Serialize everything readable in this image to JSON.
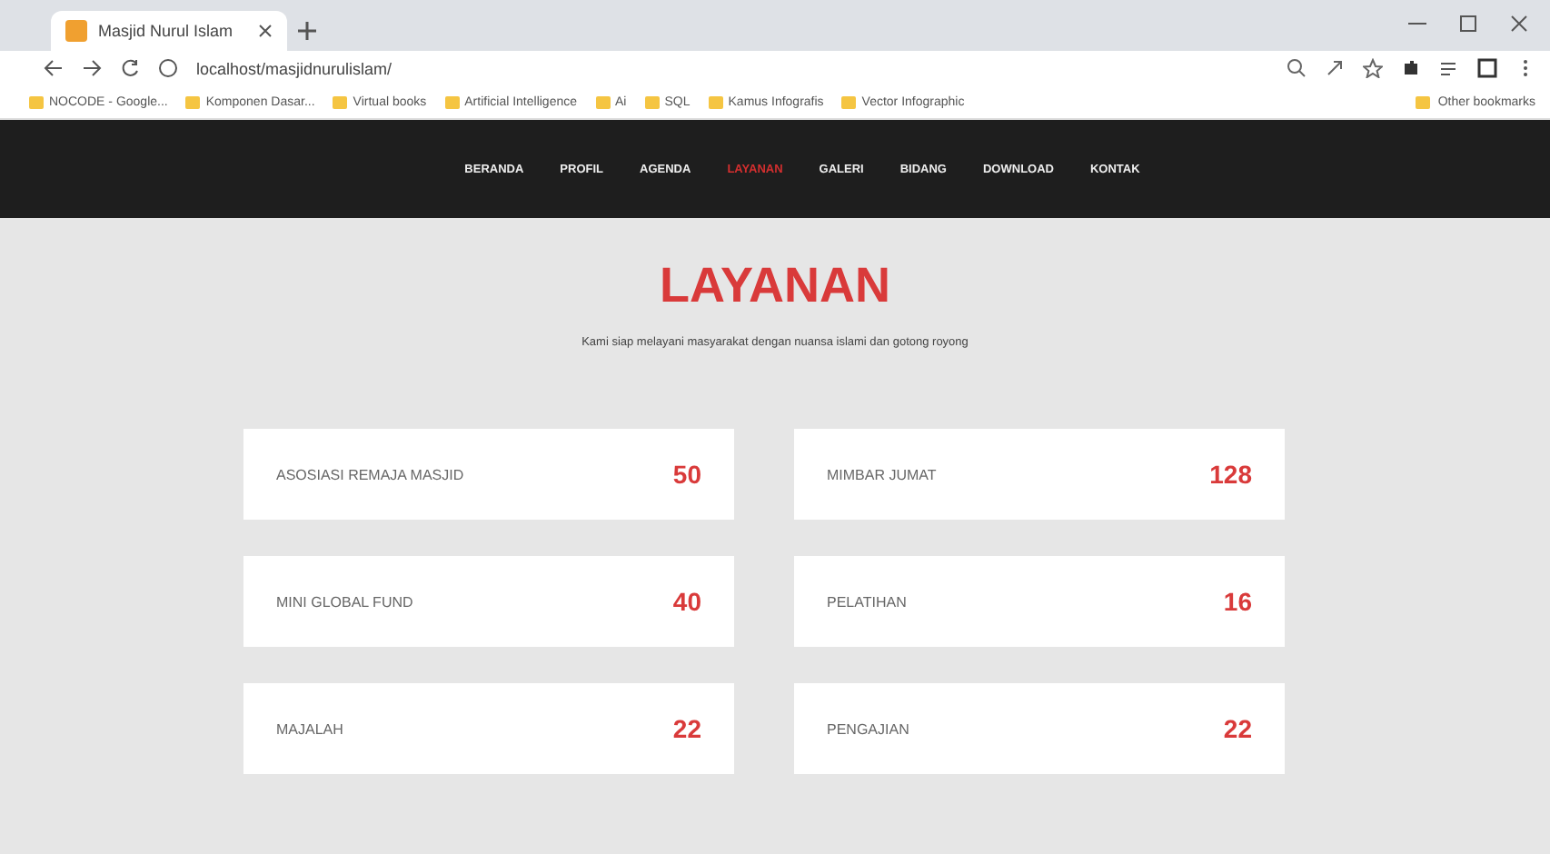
{
  "browser": {
    "tab_title": "Masjid Nurul Islam",
    "url": "localhost/masjidnurulislam/",
    "bookmarks": [
      "NOCODE - Google...",
      "Komponen Dasar...",
      "Virtual books",
      "Artificial Intelligence",
      "Ai",
      "SQL",
      "Kamus Infografis",
      "Vector Infographic"
    ],
    "other_bookmarks": "Other bookmarks"
  },
  "nav": [
    {
      "label": "BERANDA",
      "selected": false
    },
    {
      "label": "PROFIL",
      "selected": false
    },
    {
      "label": "AGENDA",
      "selected": false
    },
    {
      "label": "LAYANAN",
      "selected": true
    },
    {
      "label": "GALERI",
      "selected": false
    },
    {
      "label": "BIDANG",
      "selected": false
    },
    {
      "label": "DOWNLOAD",
      "selected": false
    },
    {
      "label": "KONTAK",
      "selected": false
    }
  ],
  "heading": "LAYANAN",
  "subtitle": "Kami siap melayani masyarakat dengan nuansa islami dan gotong royong",
  "services": [
    {
      "name": "ASOSIASI REMAJA MASJID",
      "count": "50"
    },
    {
      "name": "MIMBAR JUMAT",
      "count": "128"
    },
    {
      "name": "MINI GLOBAL FUND",
      "count": "40"
    },
    {
      "name": "PELATIHAN",
      "count": "16"
    },
    {
      "name": "MAJALAH",
      "count": "22"
    },
    {
      "name": "PENGAJIAN",
      "count": "22"
    }
  ]
}
